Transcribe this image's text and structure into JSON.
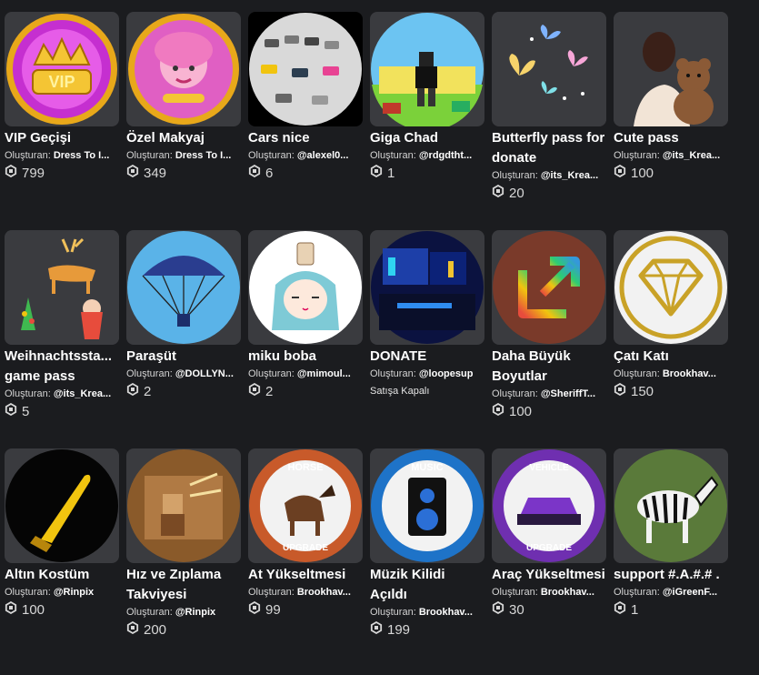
{
  "creator_prefix": "Oluşturan:",
  "items": [
    {
      "title": "VIP Geçişi",
      "creator": "Dress To I...",
      "price": "799",
      "icon": "vip-crown-icon"
    },
    {
      "title": "Özel Makyaj",
      "creator": "Dress To I...",
      "price": "349",
      "icon": "makeup-girl-icon"
    },
    {
      "title": "Cars nice",
      "creator": "@alexel0...",
      "price": "6",
      "icon": "cars-parking-icon"
    },
    {
      "title": "Giga Chad",
      "creator": "@rdgdtht...",
      "price": "1",
      "icon": "avatar-game-icon"
    },
    {
      "title": "Butterfly pass for donate",
      "creator": "@its_Krea...",
      "price": "20",
      "icon": "butterflies-icon"
    },
    {
      "title": "Cute pass",
      "creator": "@its_Krea...",
      "price": "100",
      "icon": "teddy-bear-icon"
    },
    {
      "title": "Weihnachtssta... game pass",
      "creator": "@its_Krea...",
      "price": "5",
      "icon": "christmas-reindeer-icon"
    },
    {
      "title": "Paraşüt",
      "creator": "@DOLLYN...",
      "price": "2",
      "icon": "parachute-icon"
    },
    {
      "title": "miku boba",
      "creator": "@mimoul...",
      "price": "2",
      "icon": "miku-boba-icon"
    },
    {
      "title": "DONATE",
      "creator": "@loopesup",
      "status": "Satışa Kapalı",
      "icon": "neon-room-icon"
    },
    {
      "title": "Daha Büyük Boyutlar",
      "creator": "@SheriffT...",
      "price": "100",
      "icon": "resize-arrow-icon"
    },
    {
      "title": "Çatı Katı",
      "creator": "Brookhav...",
      "price": "150",
      "icon": "diamond-icon"
    },
    {
      "title": "Altın Kostüm",
      "creator": "@Rinpix",
      "price": "100",
      "icon": "golden-knife-icon"
    },
    {
      "title": "Hız ve Zıplama Takviyesi",
      "creator": "@Rinpix",
      "price": "200",
      "icon": "speed-jump-icon"
    },
    {
      "title": "At Yükseltmesi",
      "creator": "Brookhav...",
      "price": "99",
      "icon": "horse-upgrade-icon"
    },
    {
      "title": "Müzik Kilidi Açıldı",
      "creator": "Brookhav...",
      "price": "199",
      "icon": "music-speaker-icon"
    },
    {
      "title": "Araç Yükseltmesi",
      "creator": "Brookhav...",
      "price": "30",
      "icon": "vehicle-upgrade-icon"
    },
    {
      "title": "support #.A.#.# .",
      "creator": "@iGreenF...",
      "price": "1",
      "icon": "zebra-icon"
    }
  ],
  "colors": {
    "background": "#1b1c1f",
    "tile": "#3a3b3f"
  }
}
